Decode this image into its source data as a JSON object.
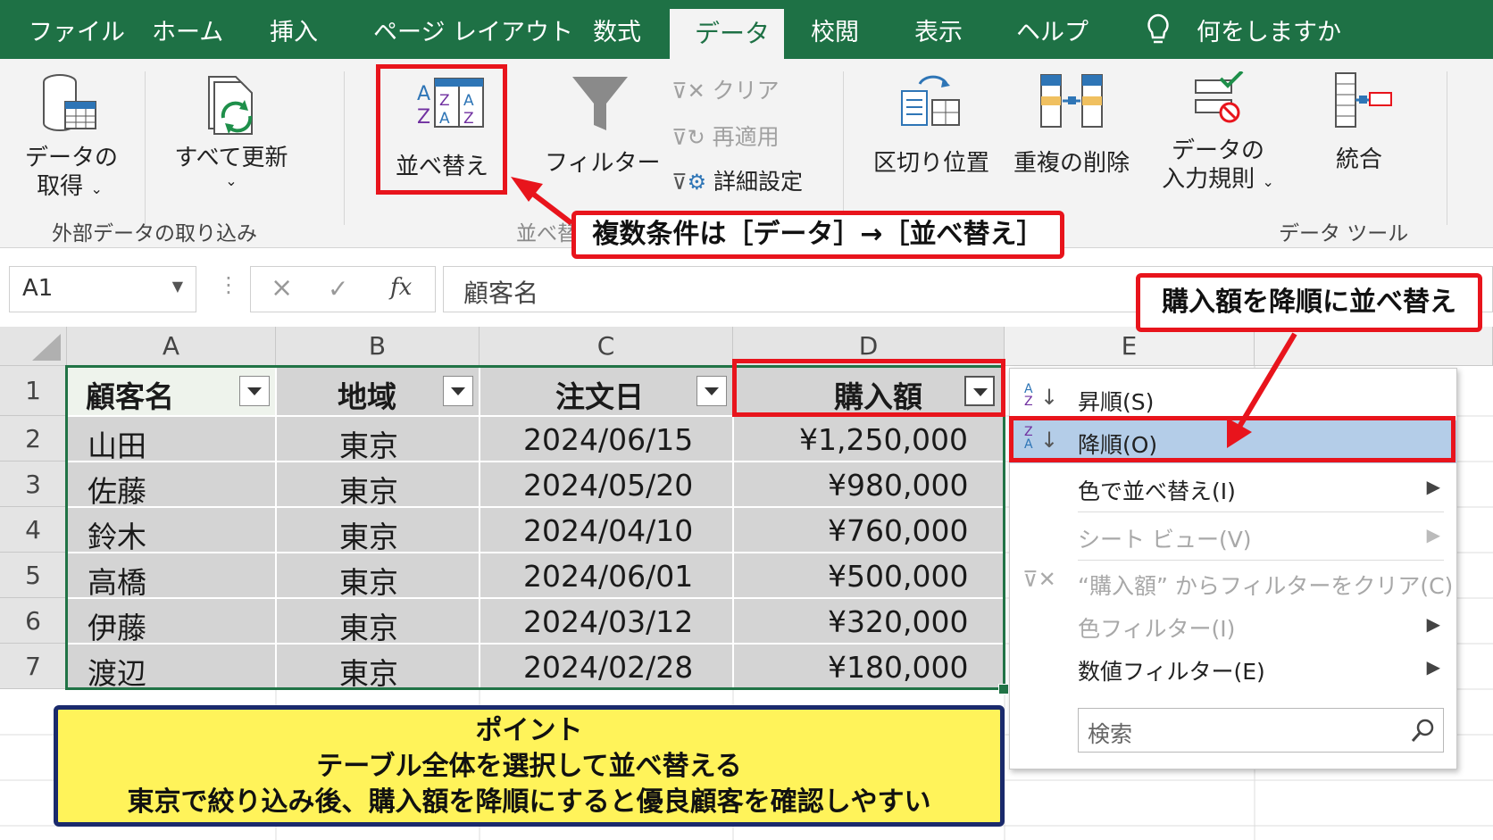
{
  "menu": {
    "tabs": [
      "ファイル",
      "ホーム",
      "挿入",
      "ページ レイアウト",
      "数式",
      "データ",
      "校閲",
      "表示",
      "ヘルプ"
    ],
    "active_tab": "データ",
    "tell_me": "何をしますか"
  },
  "ribbon": {
    "get_data_line1": "データの",
    "get_data_line2": "取得",
    "refresh_all": "すべて更新",
    "group_external": "外部データの取り込み",
    "sort": "並べ替え",
    "filter": "フィルター",
    "clear": "クリア",
    "reapply": "再適用",
    "advanced": "詳細設定",
    "group_sort_filter": "並べ替えとフィルター",
    "text_to_columns": "区切り位置",
    "remove_duplicates": "重複の削除",
    "validation_line1": "データの",
    "validation_line2": "入力規則",
    "consolidate": "統合",
    "group_data_tools": "データ ツール"
  },
  "formula_bar": {
    "name_box": "A1",
    "cancel": "×",
    "enter": "✓",
    "fx": "fx",
    "value": "顧客名"
  },
  "grid": {
    "columns": [
      "A",
      "B",
      "C",
      "D",
      "E"
    ],
    "rows": [
      "1",
      "2",
      "3",
      "4",
      "5",
      "6",
      "7"
    ],
    "headers": [
      "顧客名",
      "地域",
      "注文日",
      "購入額"
    ],
    "data": [
      [
        "山田",
        "東京",
        "2024/06/15",
        "¥1,250,000"
      ],
      [
        "佐藤",
        "東京",
        "2024/05/20",
        "¥980,000"
      ],
      [
        "鈴木",
        "東京",
        "2024/04/10",
        "¥760,000"
      ],
      [
        "高橋",
        "東京",
        "2024/06/01",
        "¥500,000"
      ],
      [
        "伊藤",
        "東京",
        "2024/03/12",
        "¥320,000"
      ],
      [
        "渡辺",
        "東京",
        "2024/02/28",
        "¥180,000"
      ]
    ]
  },
  "dropdown": {
    "ascending": "昇順(S)",
    "descending": "降順(O)",
    "sort_by_color": "色で並べ替え(I)",
    "sheet_view": "シート ビュー(V)",
    "clear_filter": "“購入額” からフィルターをクリア(C)",
    "color_filter": "色フィルター(I)",
    "number_filter": "数値フィルター(E)",
    "search_placeholder": "検索"
  },
  "annotations": {
    "callout_sort": "複数条件は［データ］→［並べ替え］",
    "callout_desc": "購入額を降順に並べ替え",
    "point_title": "ポイント",
    "point_line1": "テーブル全体を選択して並べ替える",
    "point_line2": "東京で絞り込み後、購入額を降順にすると優良顧客を確認しやすい"
  },
  "colors": {
    "excel_green": "#1e7145",
    "highlight_red": "#e8141c",
    "selection_blue": "#b4cde8",
    "point_yellow": "#fff35a",
    "point_border": "#1a2a6c"
  }
}
